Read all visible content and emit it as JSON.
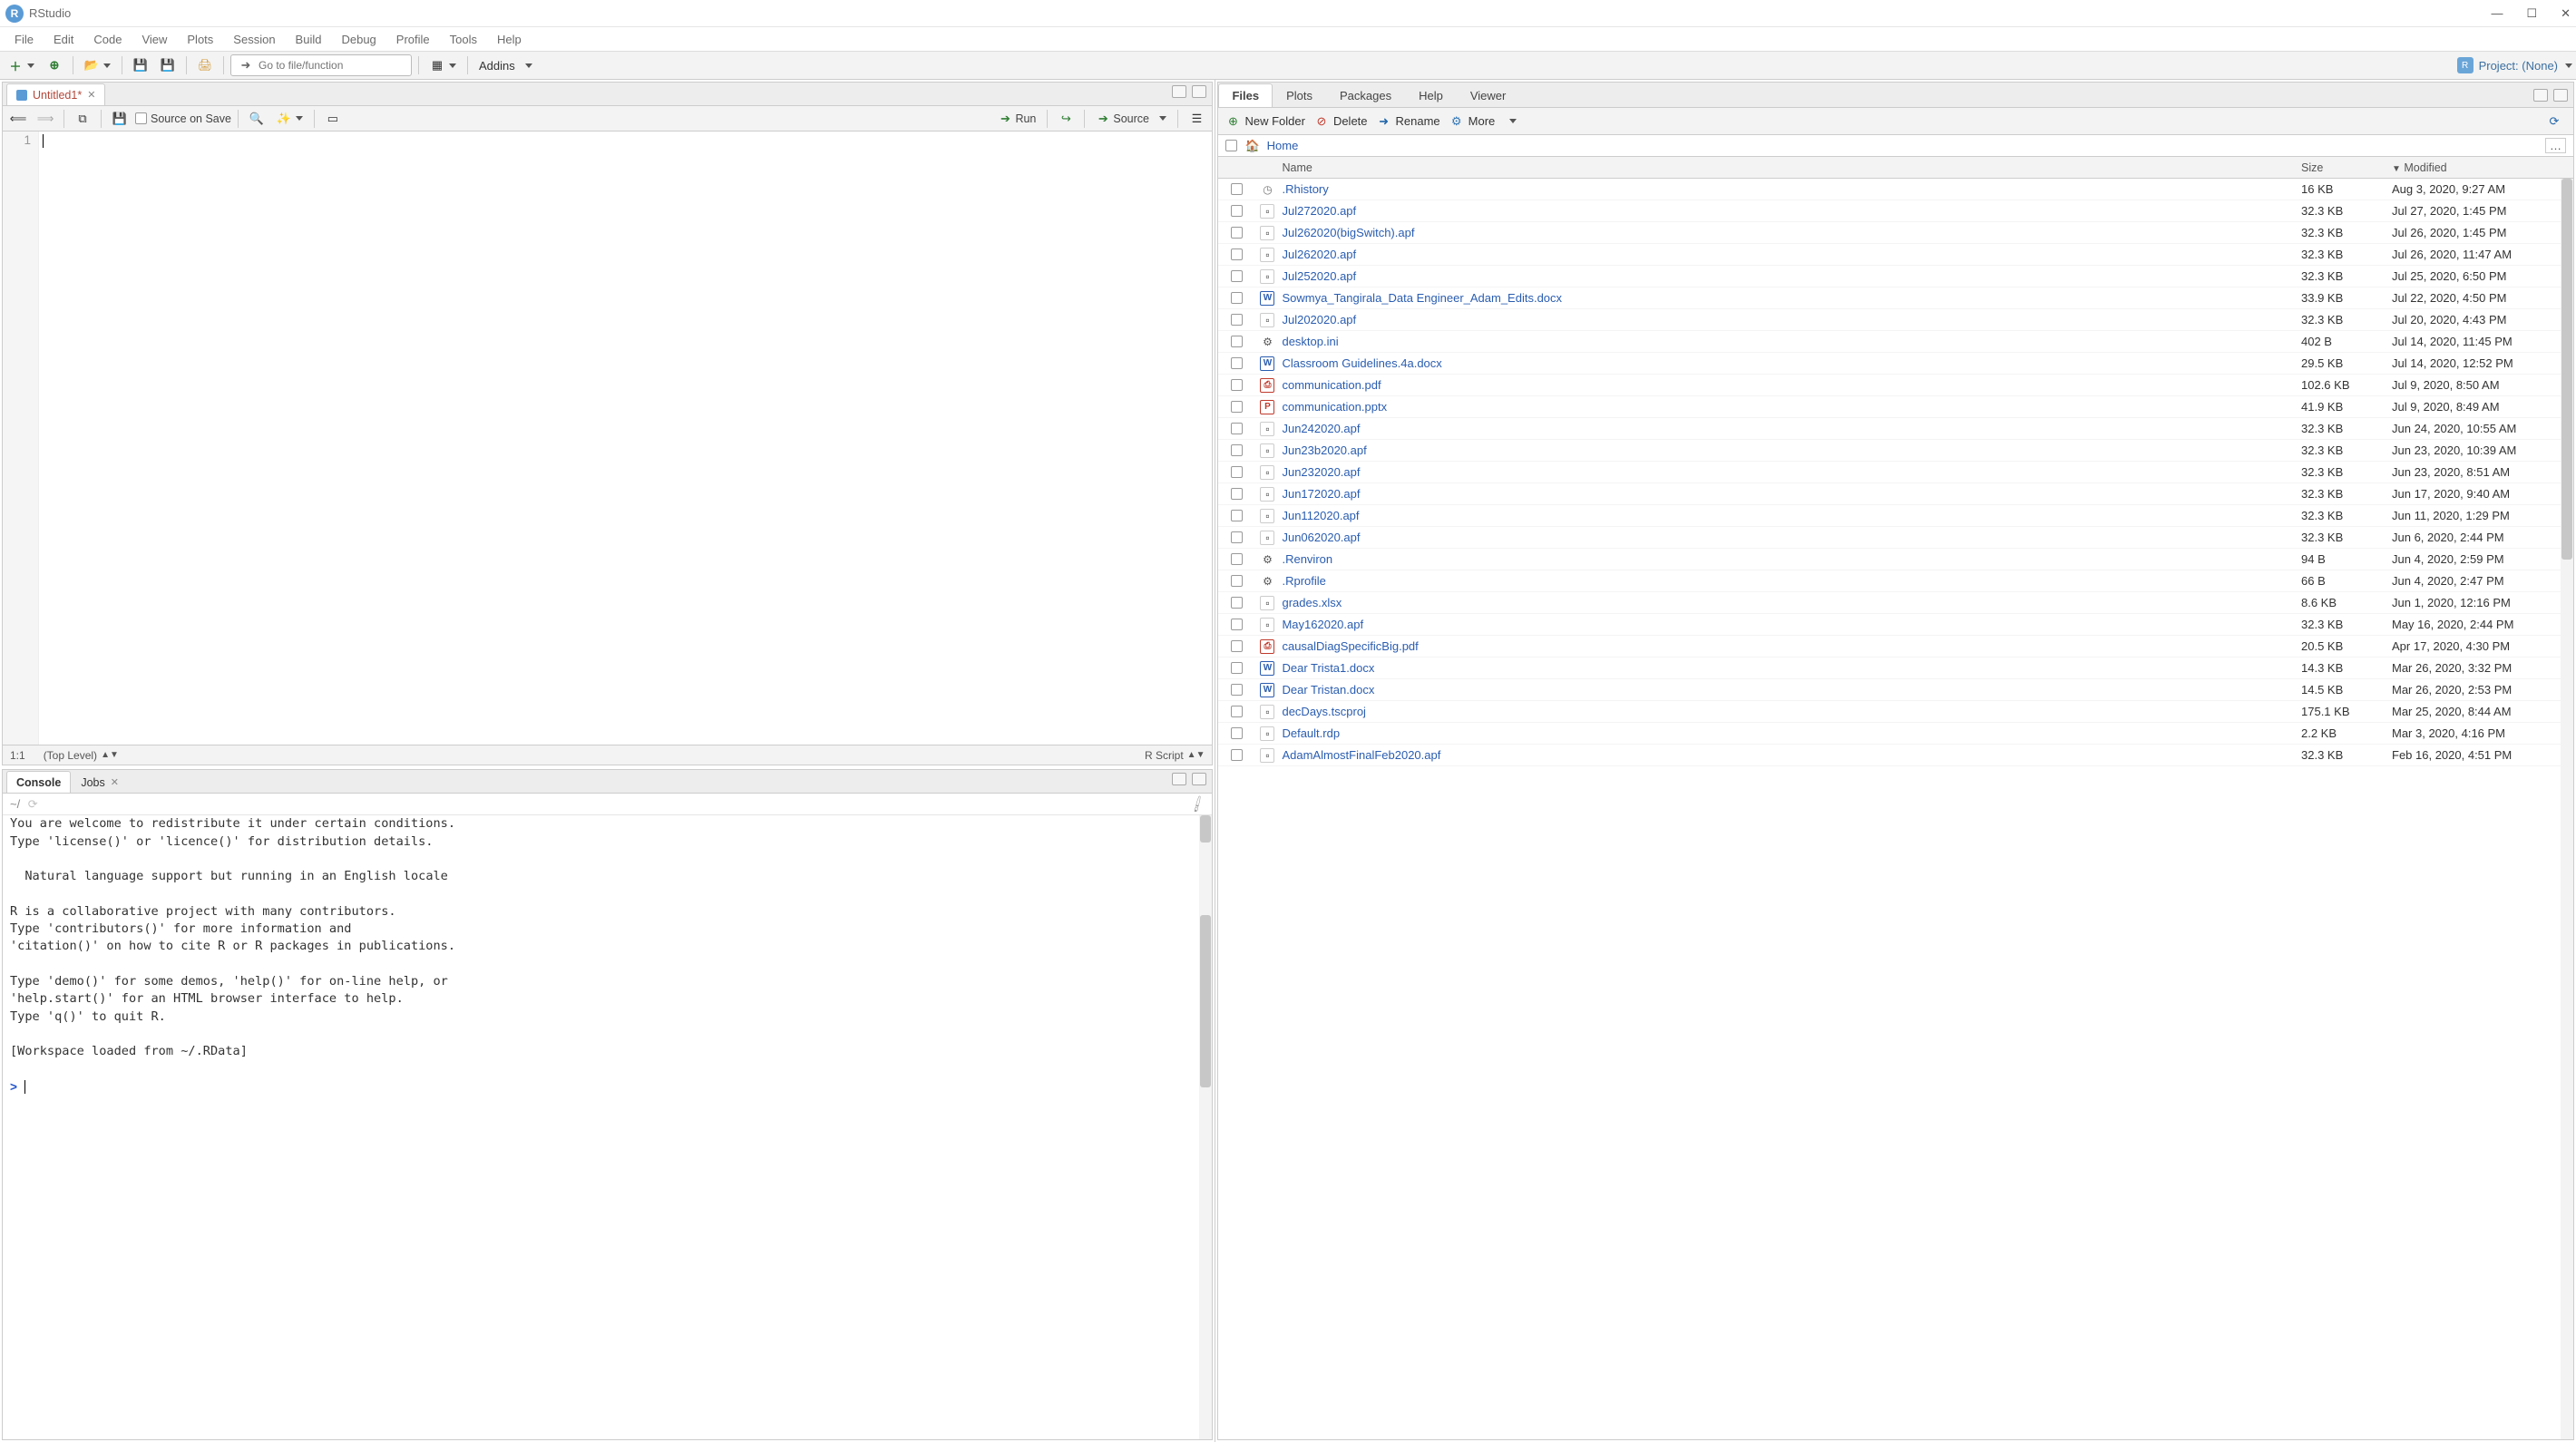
{
  "window": {
    "title": "RStudio"
  },
  "menubar": [
    "File",
    "Edit",
    "Code",
    "View",
    "Plots",
    "Session",
    "Build",
    "Debug",
    "Profile",
    "Tools",
    "Help"
  ],
  "toolbar": {
    "goto_placeholder": "Go to file/function",
    "addins": "Addins",
    "project": "Project: (None)"
  },
  "source": {
    "tab_name": "Untitled1*",
    "source_on_save": "Source on Save",
    "run": "Run",
    "source_btn": "Source",
    "status_pos": "1:1",
    "status_scope": "(Top Level)",
    "status_type": "R Script",
    "line_no": "1"
  },
  "console": {
    "tabs": [
      "Console",
      "Jobs"
    ],
    "path": "~/",
    "body_lines": [
      "You are welcome to redistribute it under certain conditions.",
      "Type 'license()' or 'licence()' for distribution details.",
      "",
      "  Natural language support but running in an English locale",
      "",
      "R is a collaborative project with many contributors.",
      "Type 'contributors()' for more information and",
      "'citation()' on how to cite R or R packages in publications.",
      "",
      "Type 'demo()' for some demos, 'help()' for on-line help, or",
      "'help.start()' for an HTML browser interface to help.",
      "Type 'q()' to quit R.",
      "",
      "[Workspace loaded from ~/.RData]",
      ""
    ],
    "prompt": ">"
  },
  "right_tabs": [
    "Files",
    "Plots",
    "Packages",
    "Help",
    "Viewer"
  ],
  "files_toolbar": {
    "new_folder": "New Folder",
    "delete": "Delete",
    "rename": "Rename",
    "more": "More"
  },
  "breadcrumb": {
    "home": "Home"
  },
  "files_header": {
    "name": "Name",
    "size": "Size",
    "modified": "Modified"
  },
  "files": [
    {
      "icon": "clock",
      "name": ".Rhistory",
      "size": "16 KB",
      "mod": "Aug 3, 2020, 9:27 AM"
    },
    {
      "icon": "file",
      "name": "Jul272020.apf",
      "size": "32.3 KB",
      "mod": "Jul 27, 2020, 1:45 PM"
    },
    {
      "icon": "file",
      "name": "Jul262020(bigSwitch).apf",
      "size": "32.3 KB",
      "mod": "Jul 26, 2020, 1:45 PM"
    },
    {
      "icon": "file",
      "name": "Jul262020.apf",
      "size": "32.3 KB",
      "mod": "Jul 26, 2020, 11:47 AM"
    },
    {
      "icon": "file",
      "name": "Jul252020.apf",
      "size": "32.3 KB",
      "mod": "Jul 25, 2020, 6:50 PM"
    },
    {
      "icon": "doc",
      "name": "Sowmya_Tangirala_Data Engineer_Adam_Edits.docx",
      "size": "33.9 KB",
      "mod": "Jul 22, 2020, 4:50 PM"
    },
    {
      "icon": "file",
      "name": "Jul202020.apf",
      "size": "32.3 KB",
      "mod": "Jul 20, 2020, 4:43 PM"
    },
    {
      "icon": "gear",
      "name": "desktop.ini",
      "size": "402 B",
      "mod": "Jul 14, 2020, 11:45 PM"
    },
    {
      "icon": "doc",
      "name": "Classroom Guidelines.4a.docx",
      "size": "29.5 KB",
      "mod": "Jul 14, 2020, 12:52 PM"
    },
    {
      "icon": "pdf",
      "name": "communication.pdf",
      "size": "102.6 KB",
      "mod": "Jul 9, 2020, 8:50 AM"
    },
    {
      "icon": "ppt",
      "name": "communication.pptx",
      "size": "41.9 KB",
      "mod": "Jul 9, 2020, 8:49 AM"
    },
    {
      "icon": "file",
      "name": "Jun242020.apf",
      "size": "32.3 KB",
      "mod": "Jun 24, 2020, 10:55 AM"
    },
    {
      "icon": "file",
      "name": "Jun23b2020.apf",
      "size": "32.3 KB",
      "mod": "Jun 23, 2020, 10:39 AM"
    },
    {
      "icon": "file",
      "name": "Jun232020.apf",
      "size": "32.3 KB",
      "mod": "Jun 23, 2020, 8:51 AM"
    },
    {
      "icon": "file",
      "name": "Jun172020.apf",
      "size": "32.3 KB",
      "mod": "Jun 17, 2020, 9:40 AM"
    },
    {
      "icon": "file",
      "name": "Jun112020.apf",
      "size": "32.3 KB",
      "mod": "Jun 11, 2020, 1:29 PM"
    },
    {
      "icon": "file",
      "name": "Jun062020.apf",
      "size": "32.3 KB",
      "mod": "Jun 6, 2020, 2:44 PM"
    },
    {
      "icon": "gear",
      "name": ".Renviron",
      "size": "94 B",
      "mod": "Jun 4, 2020, 2:59 PM"
    },
    {
      "icon": "gear",
      "name": ".Rprofile",
      "size": "66 B",
      "mod": "Jun 4, 2020, 2:47 PM"
    },
    {
      "icon": "file",
      "name": "grades.xlsx",
      "size": "8.6 KB",
      "mod": "Jun 1, 2020, 12:16 PM"
    },
    {
      "icon": "file",
      "name": "May162020.apf",
      "size": "32.3 KB",
      "mod": "May 16, 2020, 2:44 PM"
    },
    {
      "icon": "pdf",
      "name": "causalDiagSpecificBig.pdf",
      "size": "20.5 KB",
      "mod": "Apr 17, 2020, 4:30 PM"
    },
    {
      "icon": "doc",
      "name": "Dear Trista1.docx",
      "size": "14.3 KB",
      "mod": "Mar 26, 2020, 3:32 PM"
    },
    {
      "icon": "doc",
      "name": "Dear Tristan.docx",
      "size": "14.5 KB",
      "mod": "Mar 26, 2020, 2:53 PM"
    },
    {
      "icon": "file",
      "name": "decDays.tscproj",
      "size": "175.1 KB",
      "mod": "Mar 25, 2020, 8:44 AM"
    },
    {
      "icon": "file",
      "name": "Default.rdp",
      "size": "2.2 KB",
      "mod": "Mar 3, 2020, 4:16 PM"
    },
    {
      "icon": "file",
      "name": "AdamAlmostFinalFeb2020.apf",
      "size": "32.3 KB",
      "mod": "Feb 16, 2020, 4:51 PM"
    }
  ]
}
